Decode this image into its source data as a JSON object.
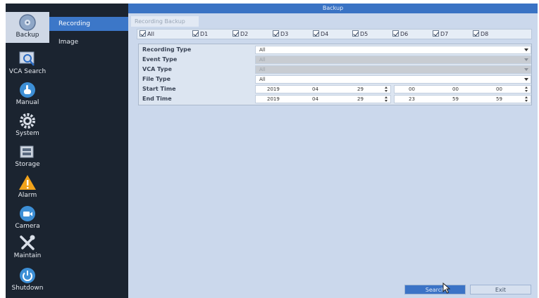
{
  "window": {
    "title": "Backup"
  },
  "rail": [
    {
      "label": "Backup",
      "icon": "backup-disc-icon",
      "active": true
    },
    {
      "label": "VCA Search",
      "icon": "vca-search-icon",
      "active": false
    },
    {
      "label": "Manual",
      "icon": "manual-hand-icon",
      "active": false
    },
    {
      "label": "System",
      "icon": "gear-icon",
      "active": false
    },
    {
      "label": "Storage",
      "icon": "storage-icon",
      "active": false
    },
    {
      "label": "Alarm",
      "icon": "warning-icon",
      "active": false
    },
    {
      "label": "Camera",
      "icon": "camera-icon",
      "active": false
    },
    {
      "label": "Maintain",
      "icon": "tools-icon",
      "active": false
    },
    {
      "label": "Shutdown",
      "icon": "power-icon",
      "active": false
    }
  ],
  "submenu": [
    {
      "label": "Recording",
      "active": true
    },
    {
      "label": "Image",
      "active": false
    }
  ],
  "tab": {
    "label": "Recording Backup"
  },
  "channels": [
    "All",
    "D1",
    "D2",
    "D3",
    "D4",
    "D5",
    "D6",
    "D7",
    "D8"
  ],
  "form": {
    "recording_type": {
      "label": "Recording Type",
      "value": "All"
    },
    "event_type": {
      "label": "Event Type",
      "value": "All"
    },
    "vca_type": {
      "label": "VCA Type",
      "value": "All"
    },
    "file_type": {
      "label": "File Type",
      "value": "All"
    },
    "start_time": {
      "label": "Start Time",
      "year": "2019",
      "month": "04",
      "day": "29",
      "hour": "00",
      "minute": "00",
      "second": "00"
    },
    "end_time": {
      "label": "End Time",
      "year": "2019",
      "month": "04",
      "day": "29",
      "hour": "23",
      "minute": "59",
      "second": "59"
    }
  },
  "buttons": {
    "search": "Search",
    "exit": "Exit"
  },
  "colors": {
    "accent": "#3a73c4",
    "rail_bg": "#1b2430",
    "panel_bg": "#cbd8ec"
  }
}
